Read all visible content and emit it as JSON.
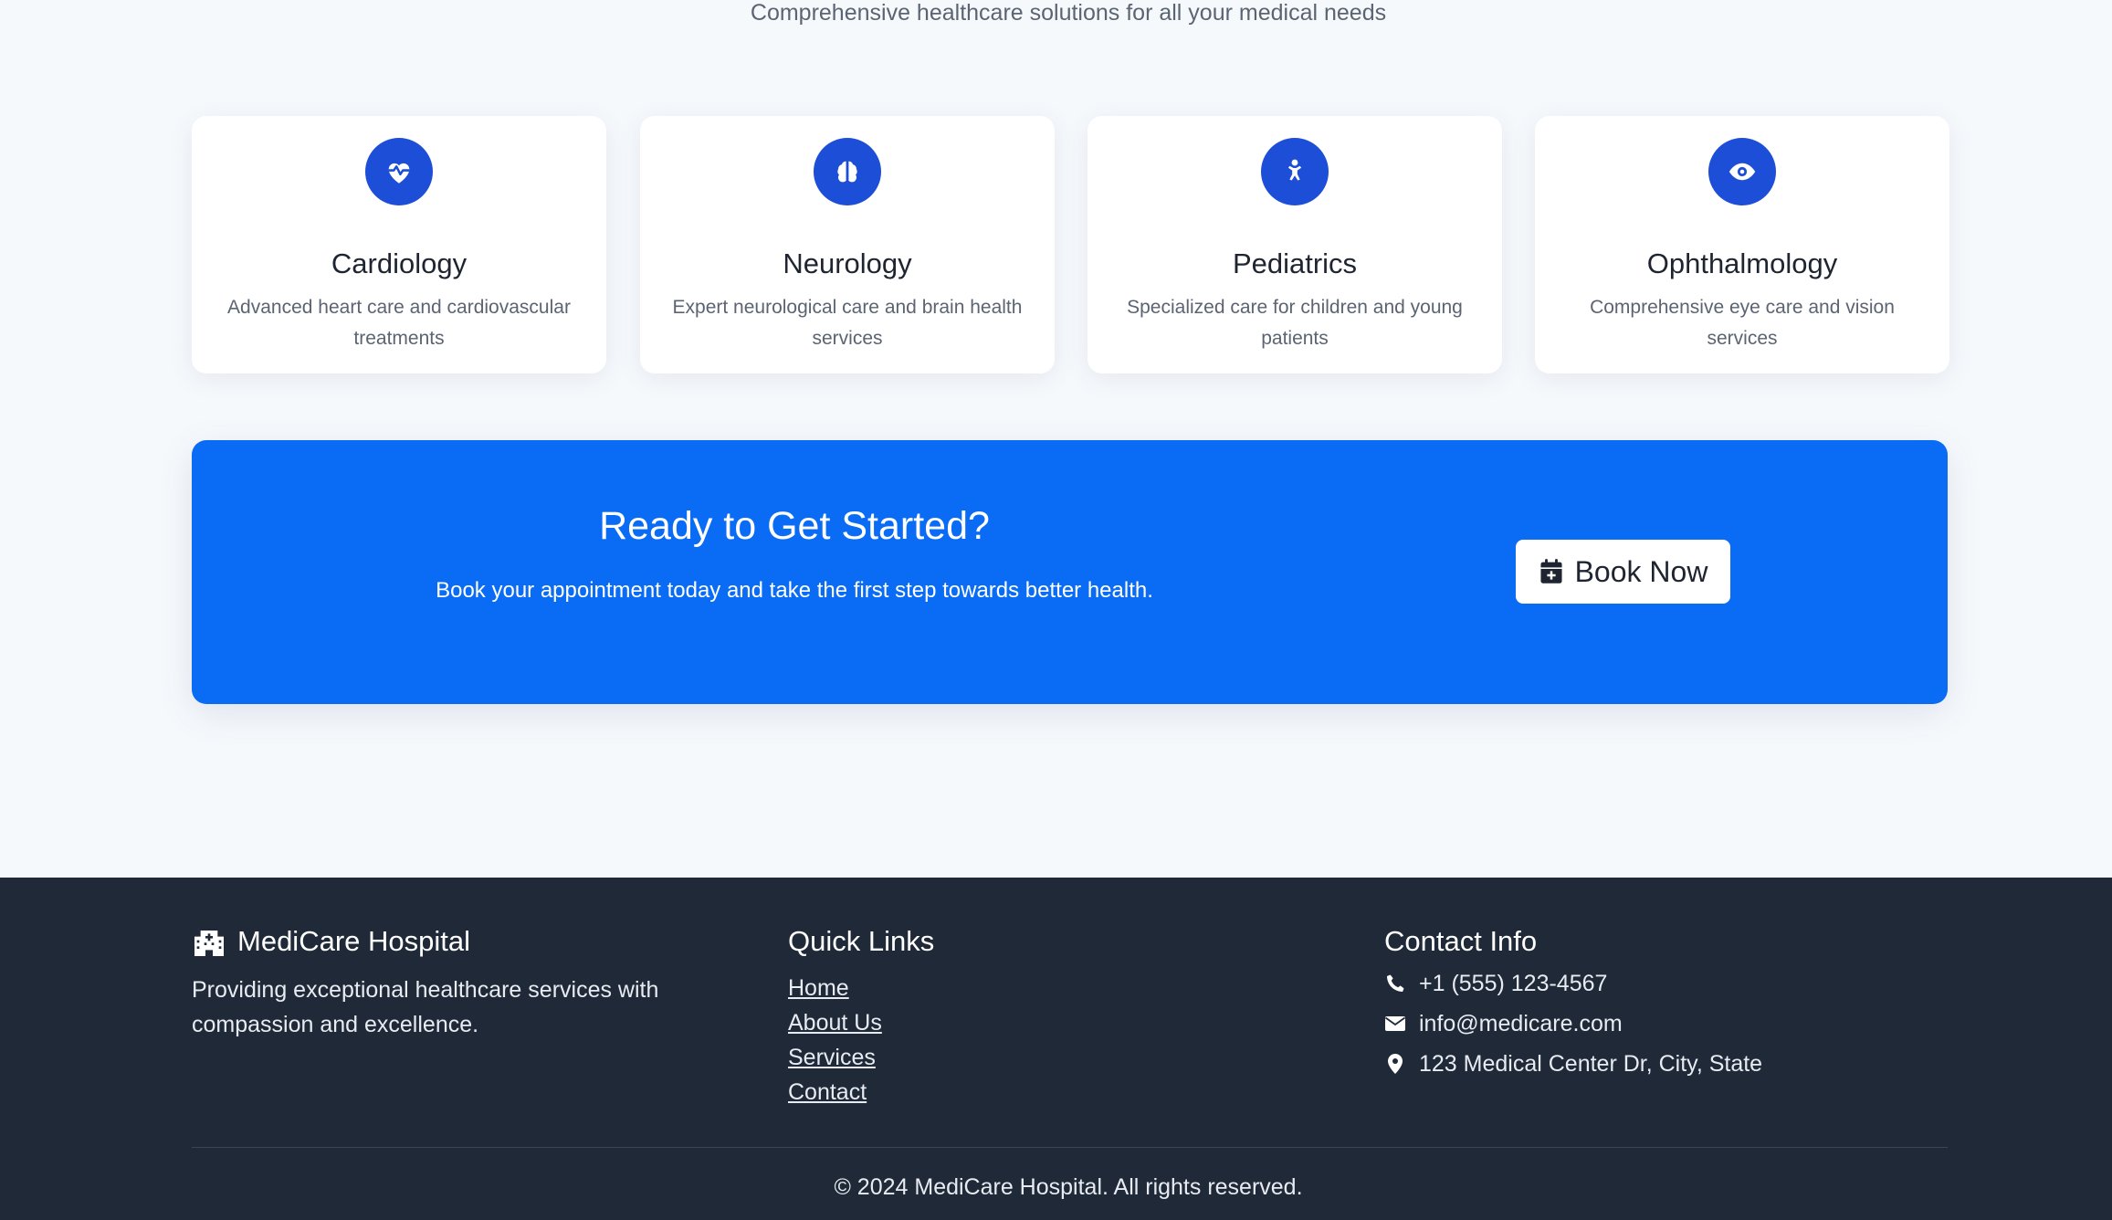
{
  "header": {
    "subtitle": "Comprehensive healthcare solutions for all your medical needs"
  },
  "services": [
    {
      "icon": "heart-pulse-icon",
      "title": "Cardiology",
      "description": "Advanced heart care and cardiovascular treatments"
    },
    {
      "icon": "brain-icon",
      "title": "Neurology",
      "description": "Expert neurological care and brain health services"
    },
    {
      "icon": "child-icon",
      "title": "Pediatrics",
      "description": "Specialized care for children and young patients"
    },
    {
      "icon": "eye-icon",
      "title": "Ophthalmology",
      "description": "Comprehensive eye care and vision services"
    }
  ],
  "cta": {
    "title": "Ready to Get Started?",
    "text": "Book your appointment today and take the first step towards better health.",
    "button_label": "Book Now",
    "button_icon": "calendar-plus-icon"
  },
  "footer": {
    "brand": {
      "name": "MediCare Hospital",
      "icon": "hospital-icon",
      "description": "Providing exceptional healthcare services with compassion and excellence."
    },
    "quick_links": {
      "heading": "Quick Links",
      "items": [
        "Home",
        "About Us",
        "Services",
        "Contact"
      ]
    },
    "contact": {
      "heading": "Contact Info",
      "phone": "+1 (555) 123-4567",
      "email": "info@medicare.com",
      "address": "123 Medical Center Dr, City, State"
    },
    "copyright": "© 2024 MediCare Hospital. All rights reserved."
  },
  "colors": {
    "primary": "#0a6cf5",
    "icon_bg": "#1d4ed8",
    "footer_bg": "#1f2937",
    "page_bg": "#f6f9fc"
  }
}
